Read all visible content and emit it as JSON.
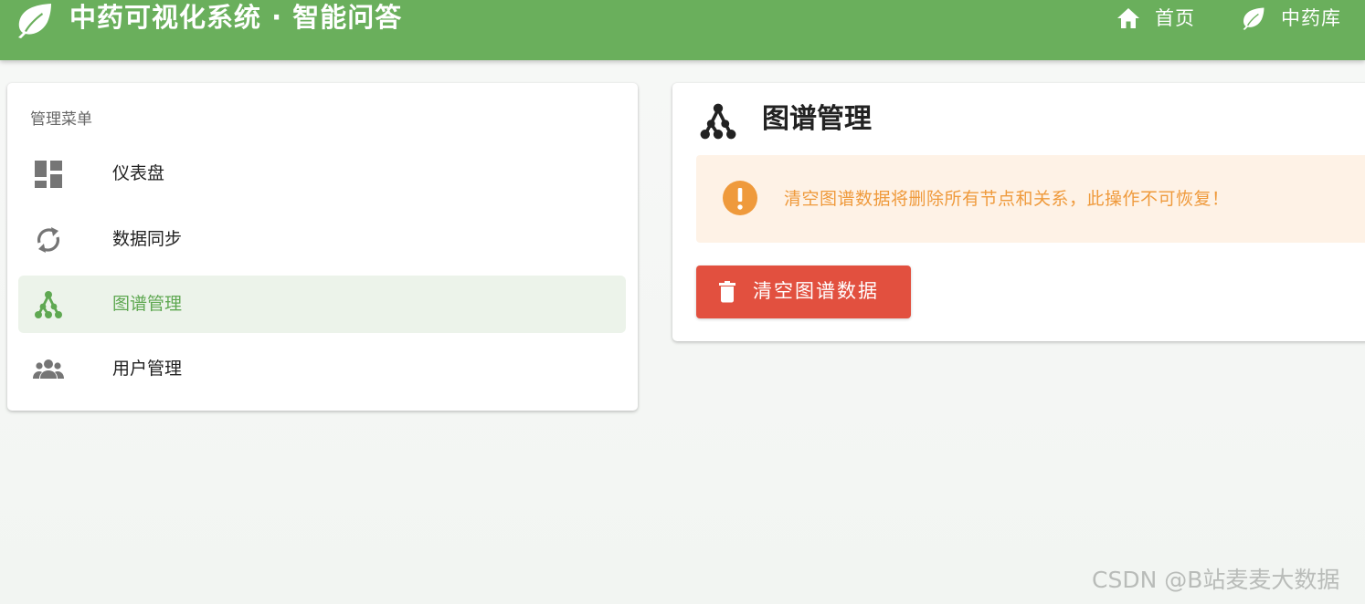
{
  "header": {
    "title": "中药可视化系统 · 智能问答",
    "logo_icon": "leaf-icon",
    "nav": [
      {
        "label": "首页",
        "icon": "home-icon"
      },
      {
        "label": "中药库",
        "icon": "leaf-icon"
      }
    ]
  },
  "sidebar": {
    "header": "管理菜单",
    "items": [
      {
        "label": "仪表盘",
        "icon": "dashboard-icon",
        "active": false
      },
      {
        "label": "数据同步",
        "icon": "sync-icon",
        "active": false
      },
      {
        "label": "图谱管理",
        "icon": "graph-icon",
        "active": true
      },
      {
        "label": "用户管理",
        "icon": "users-icon",
        "active": false
      }
    ]
  },
  "main": {
    "icon": "graph-icon",
    "title": "图谱管理",
    "alert": {
      "icon": "warning-icon",
      "text": "清空图谱数据将删除所有节点和关系，此操作不可恢复！"
    },
    "clear_button": {
      "label": "清空图谱数据",
      "icon": "trash-icon"
    }
  },
  "watermark": "CSDN @B站麦麦大数据",
  "colors": {
    "primary": "#6aaf5c",
    "active_bg": "#ecf3ea",
    "active_text": "#5fa852",
    "warning_bg": "#fef2e6",
    "warning_text": "#ef9a3c",
    "danger": "#e2503f"
  }
}
